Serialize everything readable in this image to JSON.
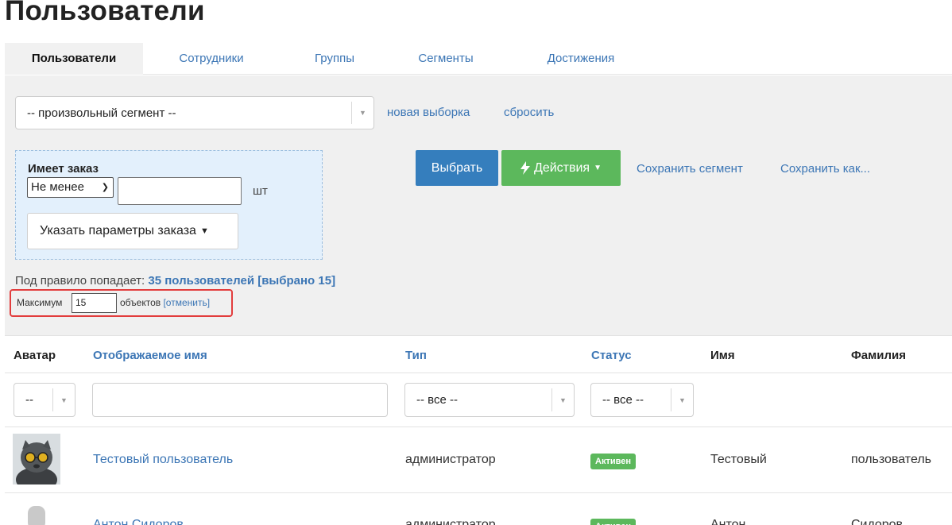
{
  "page": {
    "title": "Пользователи"
  },
  "tabs": [
    {
      "label": "Пользователи",
      "active": true
    },
    {
      "label": "Сотрудники",
      "active": false
    },
    {
      "label": "Группы",
      "active": false
    },
    {
      "label": "Сегменты",
      "active": false
    },
    {
      "label": "Достижения",
      "active": false
    }
  ],
  "segment": {
    "selected": "-- произвольный сегмент --",
    "new_selection_label": "новая выборка",
    "reset_label": "сбросить"
  },
  "rule": {
    "title": "Имеет заказ",
    "operator": "Не менее",
    "quantity_value": "",
    "unit": "шт",
    "params_button": "Указать параметры заказа"
  },
  "actions": {
    "choose_label": "Выбрать",
    "actions_label": "Действия",
    "save_segment_label": "Сохранить сегмент",
    "save_as_label": "Сохранить как..."
  },
  "summary": {
    "prefix": "Под правило попадает:",
    "count_text": "35 пользователей [выбрано 15]"
  },
  "limit": {
    "label": "Максимум",
    "value": "15",
    "unit": "объектов",
    "cancel_label": "[отменить]"
  },
  "table": {
    "columns": {
      "avatar": "Аватар",
      "display_name": "Отображаемое имя",
      "type": "Тип",
      "status": "Статус",
      "first_name": "Имя",
      "last_name": "Фамилия"
    },
    "filters": {
      "avatar": "--",
      "type": "-- все --",
      "status": "-- все --",
      "display_name": ""
    },
    "rows": [
      {
        "display_name": "Тестовый пользователь",
        "type": "администратор",
        "status": "Активен",
        "first_name": "Тестовый",
        "last_name": "пользователь"
      },
      {
        "display_name": "Антон Сидоров",
        "type": "администратор",
        "status": "Активен",
        "first_name": "Антон",
        "last_name": "Сидоров"
      }
    ]
  },
  "colors": {
    "link": "#3c76b5",
    "primary": "#357ebd",
    "success": "#5cb85c",
    "highlight": "#e23d3d"
  }
}
